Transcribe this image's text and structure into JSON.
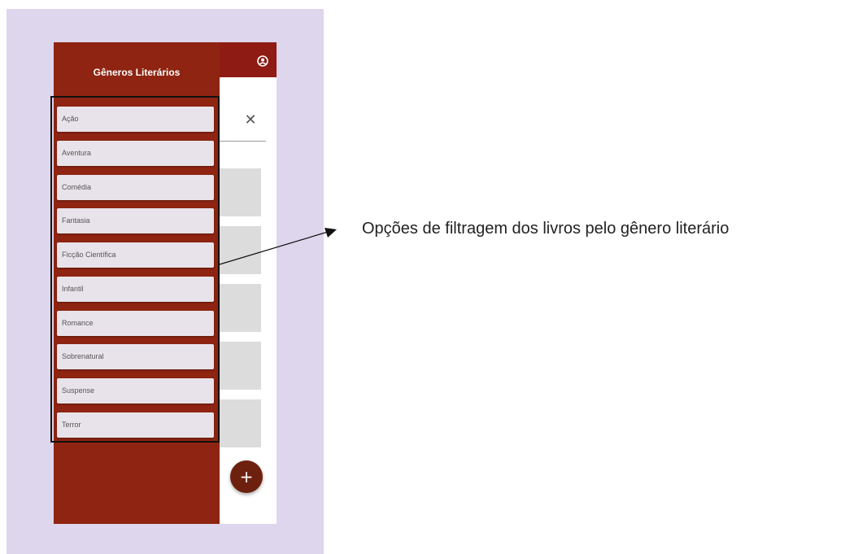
{
  "drawer": {
    "title": "Gêneros Literários",
    "genres": [
      {
        "label": "Ação"
      },
      {
        "label": "Aventura"
      },
      {
        "label": "Comédia"
      },
      {
        "label": "Fantasia"
      },
      {
        "label": "Ficção Científica"
      },
      {
        "label": "Infantil"
      },
      {
        "label": "Romance"
      },
      {
        "label": "Sobrenatural"
      },
      {
        "label": "Suspense"
      },
      {
        "label": "Terror"
      }
    ]
  },
  "app": {
    "account_icon": "account-circle-icon",
    "close_icon": "close-icon",
    "close_glyph": "✕",
    "fab_icon": "plus-icon",
    "fab_glyph": "+"
  },
  "annotation": {
    "text": "Opções de filtragem dos livros pelo gênero literário"
  },
  "colors": {
    "drawer": "#8e2411",
    "topbar": "#8e1b14",
    "fab": "#6e200f",
    "background": "#ded6ec"
  }
}
